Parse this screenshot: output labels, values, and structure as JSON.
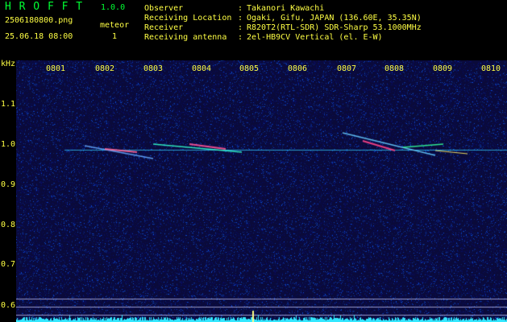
{
  "app": {
    "name": "H R O F F T",
    "version": "1.0.0"
  },
  "file": {
    "name": "2506180800.png",
    "datetime": "25.06.18 08:00"
  },
  "meteor": {
    "label": "meteor",
    "count": "1"
  },
  "info": [
    {
      "label": "Observer",
      "sep": ":",
      "value": "Takanori Kawachi"
    },
    {
      "label": "Receiving Location",
      "sep": ":",
      "value": "Ogaki, Gifu, JAPAN (136.60E, 35.35N)"
    },
    {
      "label": "Receiver",
      "sep": ":",
      "value": "R820T2(RTL-SDR) SDR-Sharp 53.1000MHz"
    },
    {
      "label": "Receiving antenna",
      "sep": ":",
      "value": "2el-HB9CV Vertical (el. E-W)"
    }
  ],
  "axis": {
    "unit": "kHz",
    "y_ticks": [
      "1.1",
      "1.0",
      "0.9",
      "0.8",
      "0.7",
      "0.6"
    ],
    "x_ticks": [
      "0801",
      "0802",
      "0803",
      "0804",
      "0805",
      "0806",
      "0807",
      "0808",
      "0809",
      "0810"
    ]
  },
  "colors": {
    "background": "#000000",
    "plot_bg": "#0a0a3a",
    "header_green": "#00ff33",
    "label_yellow": "#ffff44",
    "carrier": "#33ccff",
    "spectrum": "#33e8ff"
  }
}
